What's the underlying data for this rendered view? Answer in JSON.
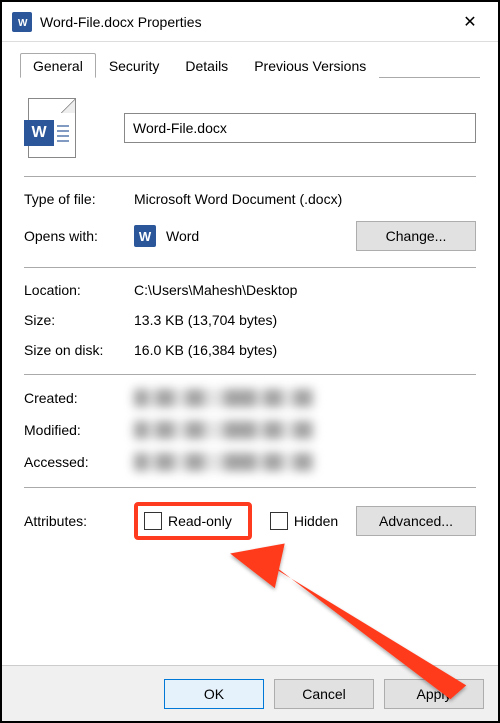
{
  "window": {
    "title": "Word-File.docx Properties"
  },
  "tabs": {
    "general": "General",
    "security": "Security",
    "details": "Details",
    "previous": "Previous Versions"
  },
  "file": {
    "filename": "Word-File.docx",
    "type_label": "Type of file:",
    "type_value": "Microsoft Word Document (.docx)",
    "opens_label": "Opens with:",
    "opens_app": "Word",
    "change_button": "Change..."
  },
  "location": {
    "label": "Location:",
    "value": "C:\\Users\\Mahesh\\Desktop"
  },
  "size": {
    "label": "Size:",
    "value": "13.3 KB (13,704 bytes)"
  },
  "size_on_disk": {
    "label": "Size on disk:",
    "value": "16.0 KB (16,384 bytes)"
  },
  "timestamps": {
    "created_label": "Created:",
    "modified_label": "Modified:",
    "accessed_label": "Accessed:"
  },
  "attributes": {
    "label": "Attributes:",
    "readonly": "Read-only",
    "hidden": "Hidden",
    "advanced": "Advanced..."
  },
  "footer": {
    "ok": "OK",
    "cancel": "Cancel",
    "apply": "Apply"
  }
}
